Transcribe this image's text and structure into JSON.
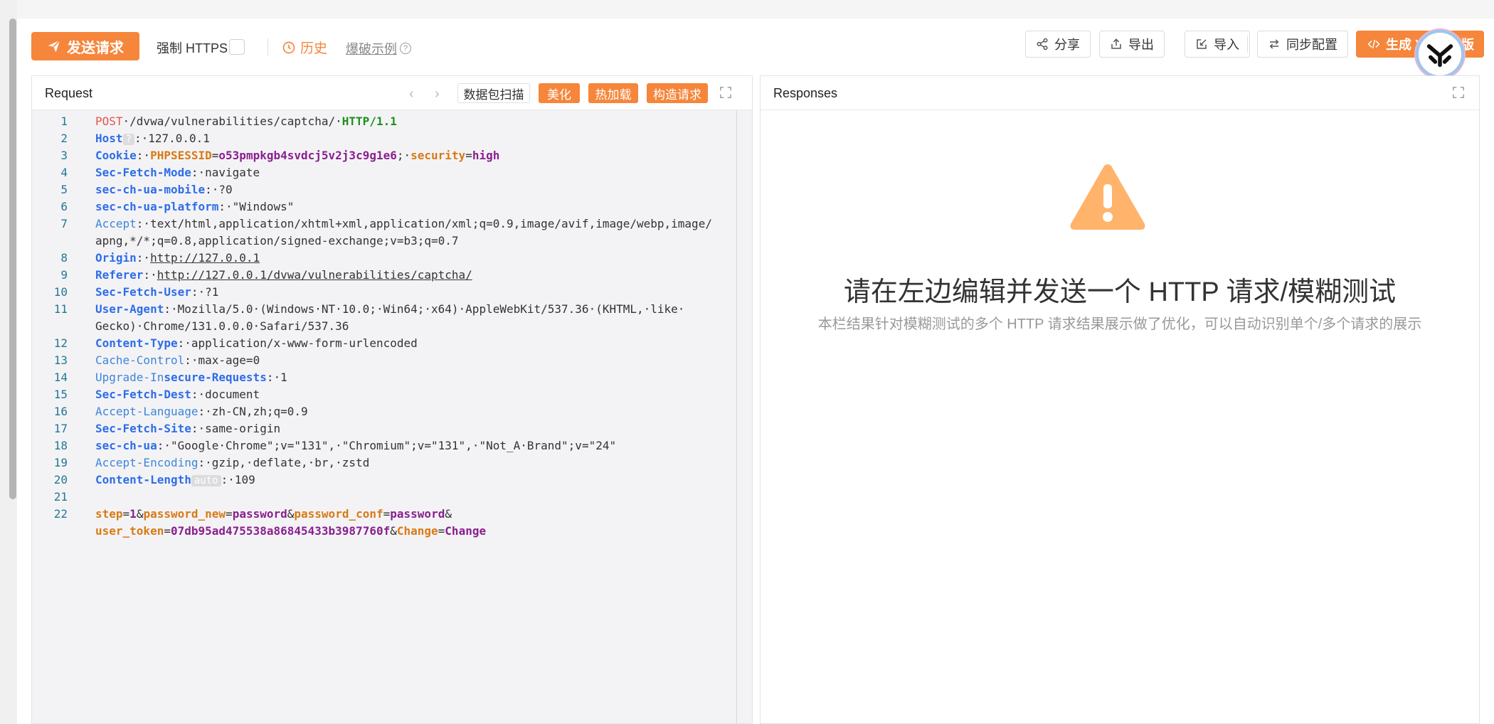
{
  "toolbar": {
    "send_label": "发送请求",
    "https_label": "强制 HTTPS",
    "history_label": "历史",
    "blast_label": "爆破示例",
    "share_label": "分享",
    "export_label": "导出",
    "import_label": "导入",
    "sync_label": "同步配置",
    "yaml_label": "生成 Yaml 模版"
  },
  "request_panel": {
    "title": "Request",
    "scan_label": "数据包扫描",
    "beautify_label": "美化",
    "hotload_label": "热加载",
    "build_label": "构造请求"
  },
  "request_lines": [
    {
      "n": "1",
      "parts": [
        [
          "method",
          "POST"
        ],
        [
          "plain",
          "·/dvwa/vulnerabilities/captcha/·"
        ],
        [
          "proto",
          "HTTP/1.1"
        ]
      ]
    },
    {
      "n": "2",
      "parts": [
        [
          "hkey",
          "Host"
        ],
        [
          "tag",
          "?"
        ],
        [
          "plain",
          ":·127.0.0.1"
        ]
      ]
    },
    {
      "n": "3",
      "parts": [
        [
          "hkey",
          "Cookie"
        ],
        [
          "plain",
          ":·"
        ],
        [
          "pname",
          "PHPSESSID"
        ],
        [
          "plain",
          "="
        ],
        [
          "pval",
          "o53pmpkgb4svdcj5v2j3c9g1e6"
        ],
        [
          "plain",
          ";·"
        ],
        [
          "pname",
          "security"
        ],
        [
          "plain",
          "="
        ],
        [
          "pval",
          "high"
        ]
      ]
    },
    {
      "n": "4",
      "parts": [
        [
          "hkey",
          "Sec-Fetch-Mode"
        ],
        [
          "plain",
          ":·navigate"
        ]
      ]
    },
    {
      "n": "5",
      "parts": [
        [
          "hkey",
          "sec-ch-ua-mobile"
        ],
        [
          "plain",
          ":·?0"
        ]
      ]
    },
    {
      "n": "6",
      "parts": [
        [
          "hkey",
          "sec-ch-ua-platform"
        ],
        [
          "plain",
          ":·\"Windows\""
        ]
      ]
    },
    {
      "n": "7",
      "parts": [
        [
          "hkeyn",
          "Accept"
        ],
        [
          "plain",
          ":·text/html,application/xhtml+xml,application/xml;q=0.9,image/avif,image/webp,image/"
        ]
      ]
    },
    {
      "n": "",
      "parts": [
        [
          "plain",
          "apng,*/*;q=0.8,application/signed-exchange;v=b3;q=0.7"
        ]
      ]
    },
    {
      "n": "8",
      "parts": [
        [
          "hkey",
          "Origin"
        ],
        [
          "plain",
          ":·"
        ],
        [
          "url",
          "http://127.0.0.1"
        ]
      ]
    },
    {
      "n": "9",
      "parts": [
        [
          "hkey",
          "Referer"
        ],
        [
          "plain",
          ":·"
        ],
        [
          "url",
          "http://127.0.0.1/dvwa/vulnerabilities/captcha/"
        ]
      ]
    },
    {
      "n": "10",
      "parts": [
        [
          "hkey",
          "Sec-Fetch-User"
        ],
        [
          "plain",
          ":·?1"
        ]
      ]
    },
    {
      "n": "11",
      "parts": [
        [
          "hkey",
          "User-Agent"
        ],
        [
          "plain",
          ":·Mozilla/5.0·(Windows·NT·10.0;·Win64;·x64)·AppleWebKit/537.36·(KHTML,·like·"
        ]
      ]
    },
    {
      "n": "",
      "parts": [
        [
          "plain",
          "Gecko)·Chrome/131.0.0.0·Safari/537.36"
        ]
      ]
    },
    {
      "n": "12",
      "parts": [
        [
          "hkey",
          "Content-Type"
        ],
        [
          "plain",
          ":·application/x-www-form-urlencoded"
        ]
      ]
    },
    {
      "n": "13",
      "parts": [
        [
          "hkeyn",
          "Cache-Control"
        ],
        [
          "plain",
          ":·max-age=0"
        ]
      ]
    },
    {
      "n": "14",
      "parts": [
        [
          "hkeyn",
          "Upgrade-In"
        ],
        [
          "hkey",
          "secure-Requests"
        ],
        [
          "plain",
          ":·1"
        ]
      ]
    },
    {
      "n": "15",
      "parts": [
        [
          "hkey",
          "Sec-Fetch-Dest"
        ],
        [
          "plain",
          ":·document"
        ]
      ]
    },
    {
      "n": "16",
      "parts": [
        [
          "hkeyn",
          "Accept-Language"
        ],
        [
          "plain",
          ":·zh-CN,zh;q=0.9"
        ]
      ]
    },
    {
      "n": "17",
      "parts": [
        [
          "hkey",
          "Sec-Fetch-Site"
        ],
        [
          "plain",
          ":·same-origin"
        ]
      ]
    },
    {
      "n": "18",
      "parts": [
        [
          "hkey",
          "sec-ch-ua"
        ],
        [
          "plain",
          ":·\"Google·Chrome\";v=\"131\",·\"Chromium\";v=\"131\",·\"Not_A·Brand\";v=\"24\""
        ]
      ]
    },
    {
      "n": "19",
      "parts": [
        [
          "hkeyn",
          "Accept-Encoding"
        ],
        [
          "plain",
          ":·gzip,·deflate,·br,·zstd"
        ]
      ]
    },
    {
      "n": "20",
      "parts": [
        [
          "hkey",
          "Content-Length"
        ],
        [
          "tag",
          "auto"
        ],
        [
          "plain",
          ":·109"
        ]
      ]
    },
    {
      "n": "21",
      "parts": []
    },
    {
      "n": "22",
      "parts": [
        [
          "pname",
          "step"
        ],
        [
          "plain",
          "="
        ],
        [
          "pval",
          "1"
        ],
        [
          "plain",
          "&"
        ],
        [
          "pname",
          "password_new"
        ],
        [
          "plain",
          "="
        ],
        [
          "pval",
          "password"
        ],
        [
          "plain",
          "&"
        ],
        [
          "pname",
          "password_conf"
        ],
        [
          "plain",
          "="
        ],
        [
          "pval",
          "password"
        ],
        [
          "plain",
          "&"
        ]
      ]
    },
    {
      "n": "",
      "parts": [
        [
          "pname",
          "user_token"
        ],
        [
          "plain",
          "="
        ],
        [
          "pval",
          "07db95ad475538a86845433b3987760f"
        ],
        [
          "plain",
          "&"
        ],
        [
          "pname",
          "Change"
        ],
        [
          "plain",
          "="
        ],
        [
          "pval",
          "Change"
        ]
      ]
    }
  ],
  "response_panel": {
    "title": "Responses",
    "empty_title": "请在左边编辑并发送一个 HTTP 请求/模糊测试",
    "empty_subtitle": "本栏结果针对模糊测试的多个 HTTP 请求结果展示做了优化，可以自动识别单个/多个请求的展示"
  },
  "colors": {
    "accent": "#f5863b",
    "warning": "#ffb36b"
  }
}
